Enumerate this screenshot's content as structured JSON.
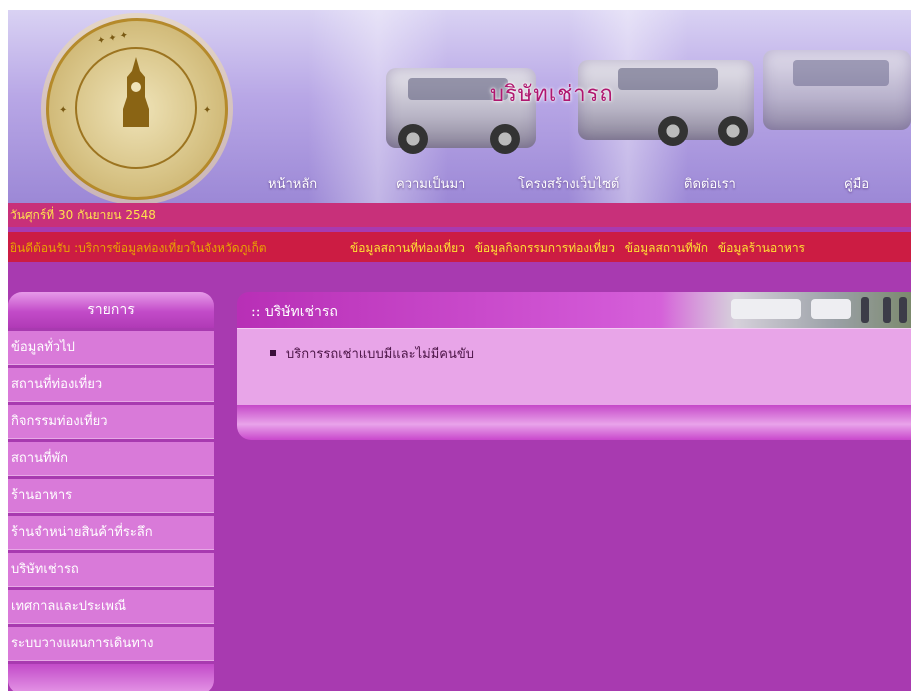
{
  "header": {
    "title": "บริษัทเช่ารถ",
    "nav": [
      "หน้าหลัก",
      "ความเป็นมา",
      "โครงสร้างเว็บไซต์",
      "ติดต่อเรา",
      "คู่มือ"
    ]
  },
  "date_text": "วันศุกร์ที่ 30 กันยายน 2548",
  "ticker": {
    "welcome": "ยินดีต้อนรับ :บริการข้อมูลท่องเที่ยวในจังหวัดภูเก็ต",
    "links": [
      "ข้อมูลสถานที่ท่องเที่ยว",
      "ข้อมูลกิจกรรมการท่องเที่ยว",
      "ข้อมูลสถานที่พัก",
      "ข้อมูลร้านอาหาร"
    ]
  },
  "sidebar": {
    "title": "รายการ",
    "items": [
      "ข้อมูลทั่วไป",
      "สถานที่ท่องเที่ยว",
      "กิจกรรมท่องเที่ยว",
      "สถานที่พัก",
      "ร้านอาหาร",
      "ร้านจำหน่ายสินค้าที่ระลึก",
      "บริษัทเช่ารถ",
      "เทศกาลและประเพณี",
      "ระบบวางแผนการเดินทาง"
    ]
  },
  "panel": {
    "title": ":: บริษัทเช่ารถ",
    "items": [
      "บริการรถเช่าแบบมีและไม่มีคนขับ"
    ]
  },
  "icons": {
    "bullet": "square-bullet-icon",
    "logo": "university-seal-logo"
  },
  "colors": {
    "frame": "#a83ab0",
    "date_bar": "#c8307a",
    "ticker_bar": "#cc1c43",
    "ticker_link": "#ffe233"
  }
}
